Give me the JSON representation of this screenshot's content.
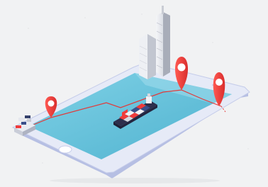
{
  "scene": {
    "subject": "isometric-phone-shipping-route",
    "icons": [
      "phone-icon",
      "location-pin-icon",
      "cargo-ship-icon",
      "skyscraper-icon",
      "shipping-container-icon"
    ],
    "colors": {
      "background": "#f1f2f3",
      "phone_body": "#e4e8f5",
      "phone_edge": "#b9c2e6",
      "screen_water": "#5bbdd8",
      "screen_water_light": "#7fd1e6",
      "pin_red": "#ef3b3b",
      "pin_dark": "#c02525",
      "route_line": "#e23a3a",
      "ship_hull": "#2e2f4d",
      "tower_light": "#e9ecf2",
      "tower_mid": "#c7cbd6",
      "tower_dark": "#8f95a3"
    }
  }
}
